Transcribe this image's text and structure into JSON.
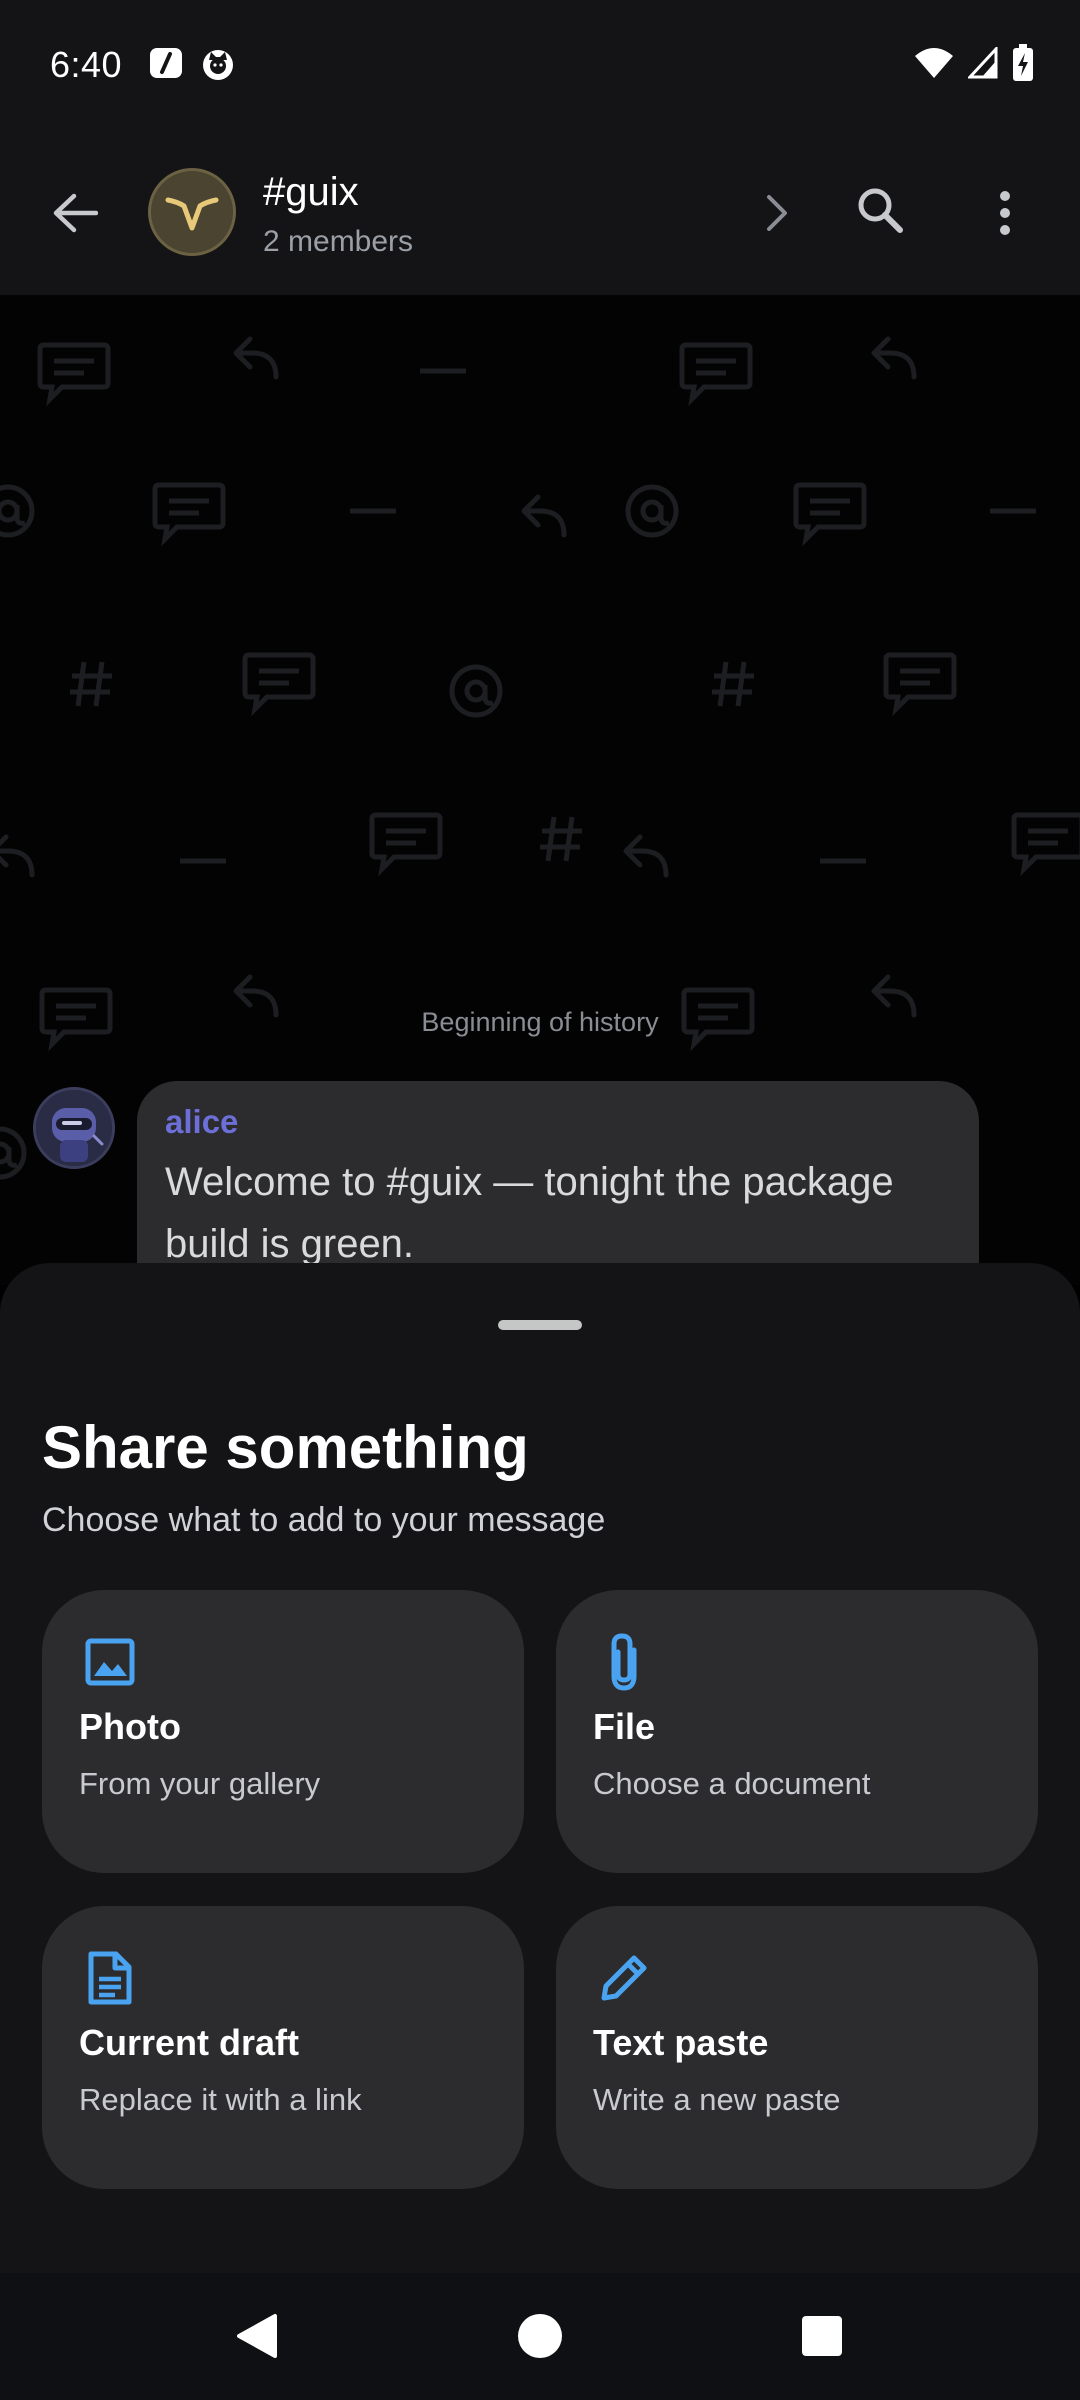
{
  "status_bar": {
    "time": "6:40"
  },
  "app_bar": {
    "room_name": "#guix",
    "room_subtitle": "2 members"
  },
  "timeline": {
    "history_label": "Beginning of history",
    "message": {
      "sender": "alice",
      "body": "Welcome to #guix — tonight the package build is green."
    }
  },
  "sheet": {
    "title": "Share something",
    "subtitle": "Choose what to add to your message",
    "options": [
      {
        "icon": "image-icon",
        "title": "Photo",
        "subtitle": "From your gallery"
      },
      {
        "icon": "paperclip-icon",
        "title": "File",
        "subtitle": "Choose a document"
      },
      {
        "icon": "document-icon",
        "title": "Current draft",
        "subtitle": "Replace it with a link"
      },
      {
        "icon": "pencil-icon",
        "title": "Text paste",
        "subtitle": "Write a new paste"
      }
    ]
  },
  "colors": {
    "accent_blue": "#4aa3f0",
    "sender_color": "#6c6fd8",
    "sheet_bg": "#141416",
    "card_bg": "#2c2c2e"
  }
}
